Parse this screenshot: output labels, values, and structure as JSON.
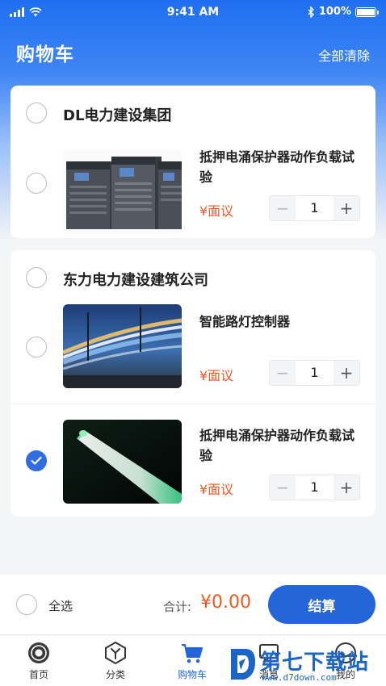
{
  "status_bar": {
    "time": "9:41 AM",
    "battery": "100%"
  },
  "header": {
    "title": "购物车",
    "clear_all": "全部清除"
  },
  "shops": [
    {
      "name": "DL电力建设集团",
      "checked": false,
      "items": [
        {
          "name": "抵押电涌保护器动作负载试验",
          "price": "¥面议",
          "quantity": "1",
          "checked": false,
          "image": "server-racks"
        }
      ]
    },
    {
      "name": "东力电力建设建筑公司",
      "checked": false,
      "items": [
        {
          "name": "智能路灯控制器",
          "price": "¥面议",
          "quantity": "1",
          "checked": false,
          "image": "light-trails"
        },
        {
          "name": "抵押电涌保护器动作负载试验",
          "price": "¥面议",
          "quantity": "1",
          "checked": true,
          "image": "green-tube"
        }
      ]
    }
  ],
  "stepper": {
    "minus": "−",
    "plus": "+"
  },
  "bottom_bar": {
    "select_all": "全选",
    "total_label": "合计:",
    "total_value": "¥0.00",
    "checkout": "结算"
  },
  "tabs": [
    {
      "label": "首页",
      "icon": "home-icon",
      "active": false
    },
    {
      "label": "分类",
      "icon": "category-icon",
      "active": false
    },
    {
      "label": "购物车",
      "icon": "cart-icon",
      "active": true
    },
    {
      "label": "消息",
      "icon": "message-icon",
      "active": false
    },
    {
      "label": "我的",
      "icon": "profile-icon",
      "active": false
    }
  ],
  "watermark": {
    "text": "第七下载站",
    "url": "www.d7down.com"
  },
  "colors": {
    "primary": "#2466d9",
    "price": "#ec5a24",
    "header_gradient_top": "#1e6ff0"
  }
}
